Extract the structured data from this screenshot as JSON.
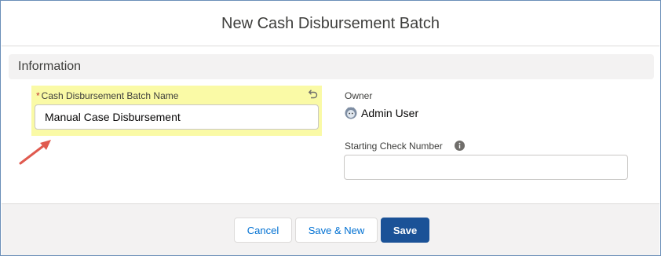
{
  "modal": {
    "title": "New Cash Disbursement Batch"
  },
  "section": {
    "title": "Information"
  },
  "fields": {
    "batch_name": {
      "required_marker": "*",
      "label": "Cash Disbursement Batch Name",
      "value": "Manual Case Disbursement"
    },
    "owner": {
      "label": "Owner",
      "value": "Admin User"
    },
    "starting_check_number": {
      "label": "Starting Check Number",
      "value": ""
    }
  },
  "footer": {
    "cancel_label": "Cancel",
    "save_new_label": "Save & New",
    "save_label": "Save"
  },
  "icons": {
    "undo": "undo-icon",
    "avatar": "user-avatar-icon",
    "info": "info-icon",
    "annotation_arrow": "arrow-icon"
  },
  "colors": {
    "highlight": "#fafaa6",
    "brand_button": "#1b5297",
    "link_blue": "#0070d2",
    "required": "#c23934",
    "annotation_arrow": "#e05a4f"
  }
}
